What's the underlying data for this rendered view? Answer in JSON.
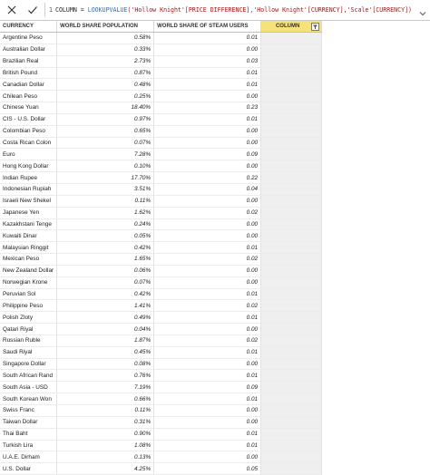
{
  "formula": {
    "line": "1",
    "prefix": "COLUMN = ",
    "func": "LOOKUPVALUE",
    "arg1": "('Hollow Knight'[PRICE DIFFERENCE],'Hollow Knight'[CURRENCY],'Scale'[CURRENCY])"
  },
  "headers": {
    "currency": "CURRENCY",
    "population": "WORLD SHARE POPULATION",
    "steam": "WORLD SHARE OF STEAM USERS",
    "column": "COLUMN"
  },
  "rows": [
    {
      "currency": "Argentine Peso",
      "population": "0.58%",
      "steam": "0.01"
    },
    {
      "currency": "Australian Dollar",
      "population": "0.33%",
      "steam": "0.00"
    },
    {
      "currency": "Brazilian Real",
      "population": "2.73%",
      "steam": "0.03"
    },
    {
      "currency": "British Pound",
      "population": "0.87%",
      "steam": "0.01"
    },
    {
      "currency": "Canadian Dollar",
      "population": "0.48%",
      "steam": "0.01"
    },
    {
      "currency": "Chilean Peso",
      "population": "0.25%",
      "steam": "0.00"
    },
    {
      "currency": "Chinese Yuan",
      "population": "18.40%",
      "steam": "0.23"
    },
    {
      "currency": "CIS - U.S. Dollar",
      "population": "0.97%",
      "steam": "0.01"
    },
    {
      "currency": "Colombian Peso",
      "population": "0.65%",
      "steam": "0.00"
    },
    {
      "currency": "Costa Rican Colon",
      "population": "0.07%",
      "steam": "0.00"
    },
    {
      "currency": "Euro",
      "population": "7.28%",
      "steam": "0.09"
    },
    {
      "currency": "Hong Kong Dollar",
      "population": "0.10%",
      "steam": "0.00"
    },
    {
      "currency": "Indian Rupee",
      "population": "17.70%",
      "steam": "0.22"
    },
    {
      "currency": "Indonesian Rupiah",
      "population": "3.51%",
      "steam": "0.04"
    },
    {
      "currency": "Israeli New Shekel",
      "population": "0.11%",
      "steam": "0.00"
    },
    {
      "currency": "Japanese Yen",
      "population": "1.62%",
      "steam": "0.02"
    },
    {
      "currency": "Kazakhstani Tenge",
      "population": "0.24%",
      "steam": "0.00"
    },
    {
      "currency": "Kuwaiti Dinar",
      "population": "0.05%",
      "steam": "0.00"
    },
    {
      "currency": "Malaysian Ringgit",
      "population": "0.42%",
      "steam": "0.01"
    },
    {
      "currency": "Mexican Peso",
      "population": "1.65%",
      "steam": "0.02"
    },
    {
      "currency": "New Zealand Dollar",
      "population": "0.06%",
      "steam": "0.00"
    },
    {
      "currency": "Norwegian Krone",
      "population": "0.07%",
      "steam": "0.00"
    },
    {
      "currency": "Peruvian Sol",
      "population": "0.42%",
      "steam": "0.01"
    },
    {
      "currency": "Philippine Peso",
      "population": "1.41%",
      "steam": "0.02"
    },
    {
      "currency": "Polish Zloty",
      "population": "0.49%",
      "steam": "0.01"
    },
    {
      "currency": "Qatari Riyal",
      "population": "0.04%",
      "steam": "0.00"
    },
    {
      "currency": "Russian Ruble",
      "population": "1.87%",
      "steam": "0.02"
    },
    {
      "currency": "Saudi Riyal",
      "population": "0.45%",
      "steam": "0.01"
    },
    {
      "currency": "Singapore Dollar",
      "population": "0.08%",
      "steam": "0.00"
    },
    {
      "currency": "South African Rand",
      "population": "0.76%",
      "steam": "0.01"
    },
    {
      "currency": "South Asia - USD",
      "population": "7.19%",
      "steam": "0.09"
    },
    {
      "currency": "South Korean Won",
      "population": "0.66%",
      "steam": "0.01"
    },
    {
      "currency": "Swiss Franc",
      "population": "0.11%",
      "steam": "0.00"
    },
    {
      "currency": "Taiwan Dollar",
      "population": "0.31%",
      "steam": "0.00"
    },
    {
      "currency": "Thai Baht",
      "population": "0.90%",
      "steam": "0.01"
    },
    {
      "currency": "Turkish Lira",
      "population": "1.08%",
      "steam": "0.01"
    },
    {
      "currency": "U.A.E. Dirham",
      "population": "0.13%",
      "steam": "0.00"
    },
    {
      "currency": "U.S. Dollar",
      "population": "4.25%",
      "steam": "0.05"
    }
  ]
}
